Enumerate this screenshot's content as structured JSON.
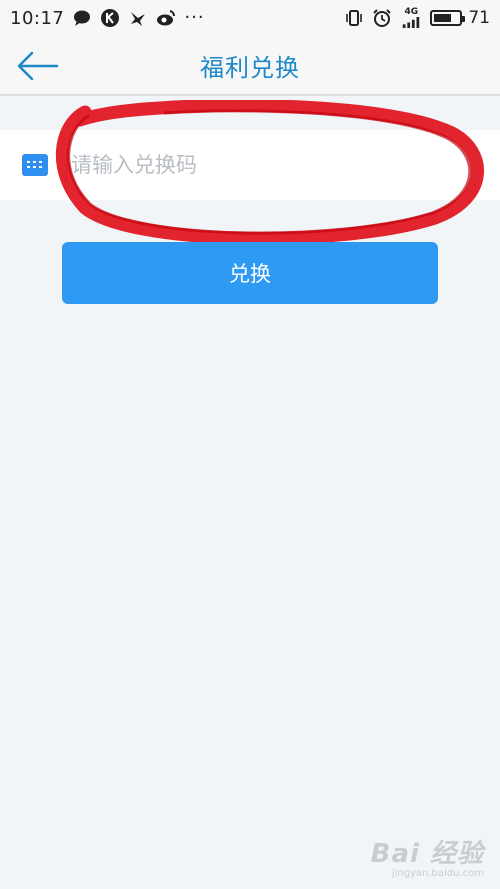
{
  "status_bar": {
    "time": "10:17",
    "left_icons": [
      "message-icon",
      "k-app-icon",
      "bird-app-icon",
      "weibo-icon"
    ],
    "more": "···",
    "network": "4G",
    "battery_level": "71",
    "battery_fraction": 0.71
  },
  "nav": {
    "back_icon": "back-arrow-icon",
    "title": "福利兑换"
  },
  "form": {
    "input_placeholder": "请输入兑换码",
    "input_value": "",
    "submit_label": "兑换"
  },
  "watermark": {
    "logo": "Bai 经验",
    "url": "jingyan.baidu.com"
  },
  "colors": {
    "accent": "#2f9af3",
    "title": "#1e88c8",
    "annotation": "#e0111c",
    "background": "#f2f5f8"
  }
}
